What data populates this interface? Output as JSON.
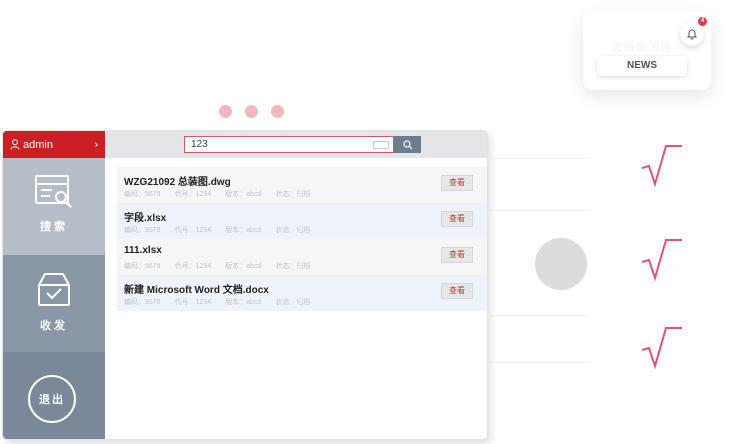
{
  "sidebar": {
    "user": "admin",
    "nav_search_label": "搜索",
    "nav_inbox_label": "收发",
    "logout_label": "退出"
  },
  "search": {
    "value": "123"
  },
  "files": [
    {
      "name": "WZG21092 总装图.dwg",
      "meta": [
        "编码：5678",
        "代号：1234",
        "版本：abcd",
        "状态：归档"
      ],
      "view_label": "查看"
    },
    {
      "name": "字段.xlsx",
      "meta": [
        "编码：5678",
        "代号：1234",
        "版本：abcd",
        "状态：归档"
      ],
      "view_label": "查看"
    },
    {
      "name": "111.xlsx",
      "meta": [
        "编码：5678",
        "代号：1234",
        "版本：abcd",
        "状态：归档"
      ],
      "view_label": "查看"
    },
    {
      "name": "新建 Microsoft Word 文档.docx",
      "meta": [
        "编码：5678",
        "代号：1234",
        "版本：abcd",
        "状态：归档"
      ],
      "view_label": "查看"
    }
  ],
  "news": {
    "badge": "4",
    "faint_text": "您有新消息",
    "button_label": "NEWS"
  },
  "colors": {
    "accent_red": "#cc1f25",
    "sidebar": "#7a8899",
    "check_pink": "#e0547a"
  },
  "icons": [
    "user-icon",
    "chevron-right-icon",
    "search-list-icon",
    "inbox-box-icon",
    "search-icon",
    "keyboard-icon",
    "bell-icon",
    "check-mark-icon"
  ]
}
